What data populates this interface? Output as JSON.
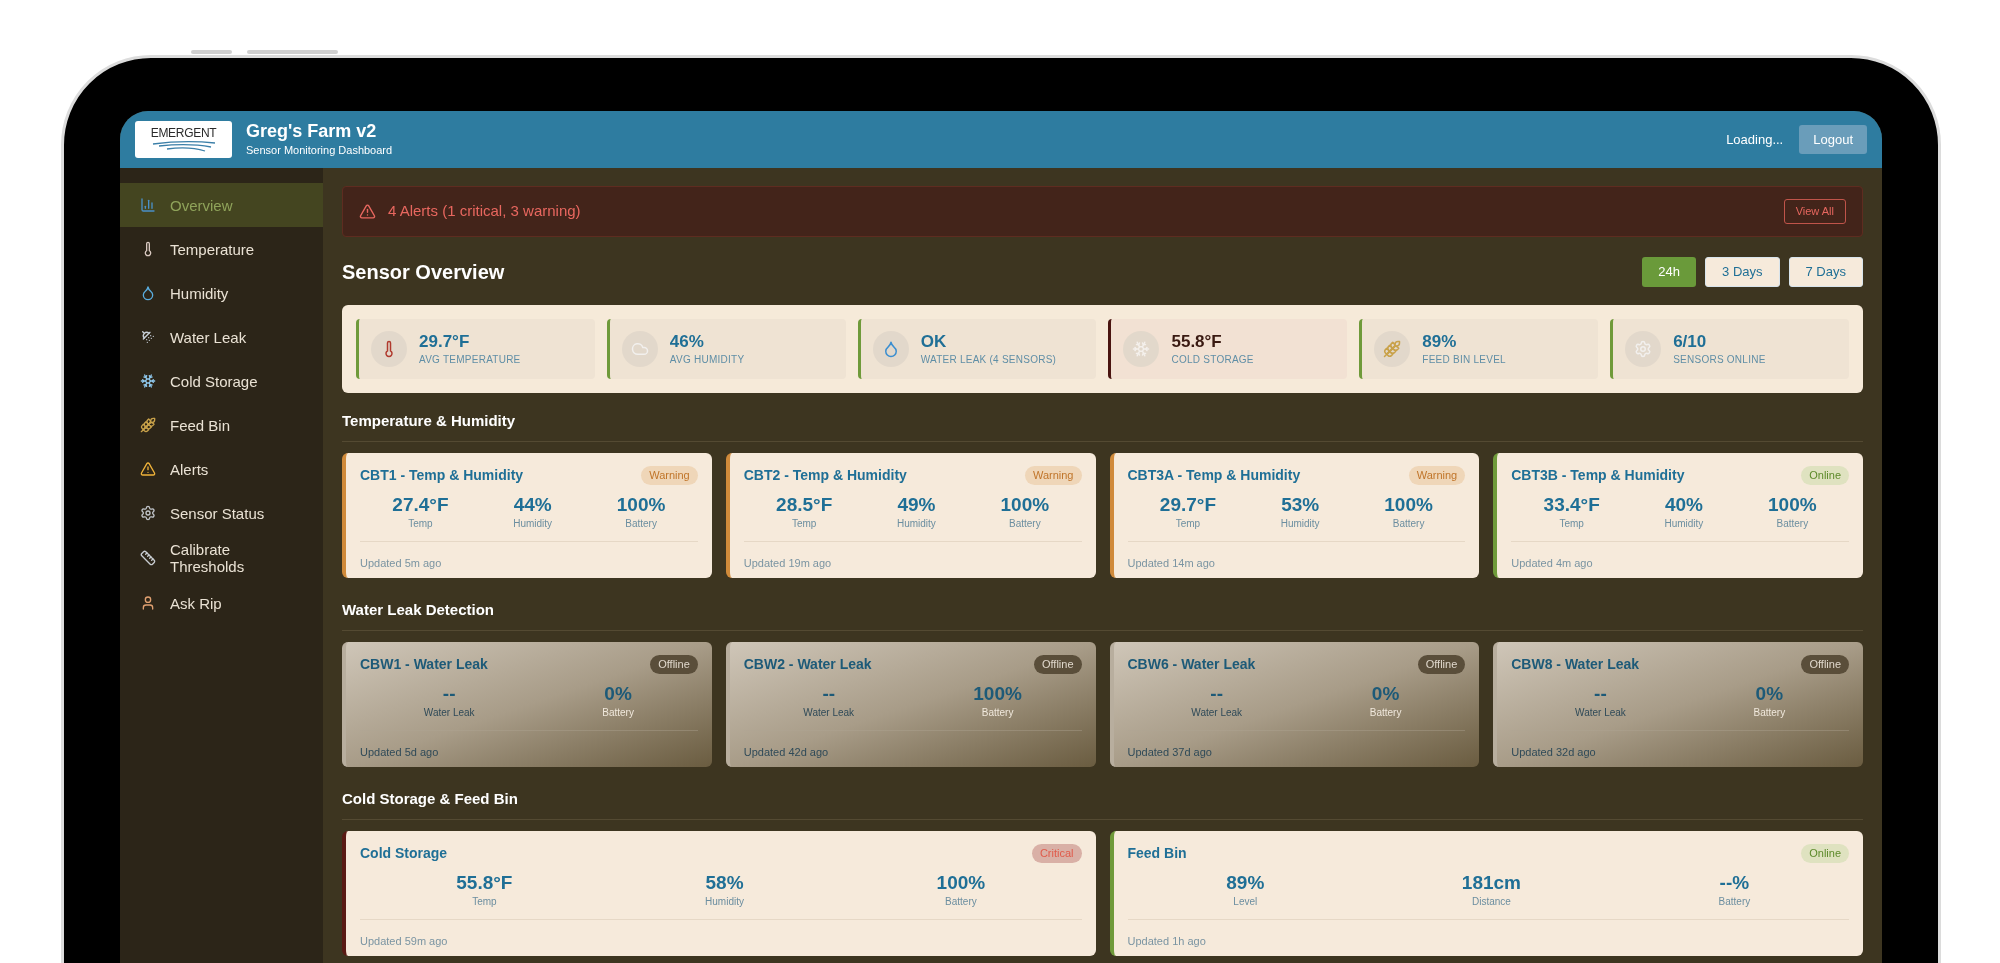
{
  "header": {
    "logo": "EMERGENT",
    "title": "Greg's Farm v2",
    "subtitle": "Sensor Monitoring Dashboard",
    "status": "Loading...",
    "logout": "Logout"
  },
  "sidebar": {
    "items": [
      {
        "label": "Overview",
        "selected": true
      },
      {
        "label": "Temperature",
        "selected": false
      },
      {
        "label": "Humidity",
        "selected": false
      },
      {
        "label": "Water Leak",
        "selected": false
      },
      {
        "label": "Cold Storage",
        "selected": false
      },
      {
        "label": "Feed Bin",
        "selected": false
      },
      {
        "label": "Alerts",
        "selected": false
      },
      {
        "label": "Sensor Status",
        "selected": false
      },
      {
        "label": "Calibrate Thresholds",
        "selected": false
      },
      {
        "label": "Ask Rip",
        "selected": false
      }
    ]
  },
  "alert": {
    "text": "4 Alerts (1 critical, 3 warning)",
    "button": "View All"
  },
  "overview": {
    "title": "Sensor Overview",
    "ranges": [
      {
        "label": "24h",
        "selected": true
      },
      {
        "label": "3 Days",
        "selected": false
      },
      {
        "label": "7 Days",
        "selected": false
      }
    ],
    "summary": [
      {
        "value": "29.7°F",
        "label": "AVG TEMPERATURE",
        "kind": "ok"
      },
      {
        "value": "46%",
        "label": "AVG HUMIDITY",
        "kind": "ok"
      },
      {
        "value": "OK",
        "label": "WATER LEAK (4 SENSORS)",
        "kind": "ok"
      },
      {
        "value": "55.8°F",
        "label": "COLD STORAGE",
        "kind": "critical"
      },
      {
        "value": "89%",
        "label": "FEED BIN LEVEL",
        "kind": "ok"
      },
      {
        "value": "6/10",
        "label": "SENSORS ONLINE",
        "kind": "ok"
      }
    ]
  },
  "sections": [
    {
      "title": "Temperature & Humidity",
      "cards": [
        {
          "name": "CBT1 - Temp & Humidity",
          "badge": "Warning",
          "kind": "warning",
          "metrics": [
            {
              "value": "27.4°F",
              "label": "Temp"
            },
            {
              "value": "44%",
              "label": "Humidity"
            },
            {
              "value": "100%",
              "label": "Battery"
            }
          ],
          "updated": "Updated 5m ago"
        },
        {
          "name": "CBT2 - Temp & Humidity",
          "badge": "Warning",
          "kind": "warning",
          "metrics": [
            {
              "value": "28.5°F",
              "label": "Temp"
            },
            {
              "value": "49%",
              "label": "Humidity"
            },
            {
              "value": "100%",
              "label": "Battery"
            }
          ],
          "updated": "Updated 19m ago"
        },
        {
          "name": "CBT3A - Temp & Humidity",
          "badge": "Warning",
          "kind": "warning",
          "metrics": [
            {
              "value": "29.7°F",
              "label": "Temp"
            },
            {
              "value": "53%",
              "label": "Humidity"
            },
            {
              "value": "100%",
              "label": "Battery"
            }
          ],
          "updated": "Updated 14m ago"
        },
        {
          "name": "CBT3B - Temp & Humidity",
          "badge": "Online",
          "kind": "online",
          "metrics": [
            {
              "value": "33.4°F",
              "label": "Temp"
            },
            {
              "value": "40%",
              "label": "Humidity"
            },
            {
              "value": "100%",
              "label": "Battery"
            }
          ],
          "updated": "Updated 4m ago"
        }
      ]
    },
    {
      "title": "Water Leak Detection",
      "cards": [
        {
          "name": "CBW1 - Water Leak",
          "badge": "Offline",
          "kind": "offline",
          "metrics": [
            {
              "value": "--",
              "label": "Water Leak"
            },
            {
              "value": "0%",
              "label": "Battery"
            }
          ],
          "updated": "Updated 5d ago"
        },
        {
          "name": "CBW2 - Water Leak",
          "badge": "Offline",
          "kind": "offline",
          "metrics": [
            {
              "value": "--",
              "label": "Water Leak"
            },
            {
              "value": "100%",
              "label": "Battery"
            }
          ],
          "updated": "Updated 42d ago"
        },
        {
          "name": "CBW6 - Water Leak",
          "badge": "Offline",
          "kind": "offline",
          "metrics": [
            {
              "value": "--",
              "label": "Water Leak"
            },
            {
              "value": "0%",
              "label": "Battery"
            }
          ],
          "updated": "Updated 37d ago"
        },
        {
          "name": "CBW8 - Water Leak",
          "badge": "Offline",
          "kind": "offline",
          "metrics": [
            {
              "value": "--",
              "label": "Water Leak"
            },
            {
              "value": "0%",
              "label": "Battery"
            }
          ],
          "updated": "Updated 32d ago"
        }
      ]
    },
    {
      "title": "Cold Storage & Feed Bin",
      "cards": [
        {
          "name": "Cold Storage",
          "badge": "Critical",
          "kind": "critical",
          "metrics": [
            {
              "value": "55.8°F",
              "label": "Temp"
            },
            {
              "value": "58%",
              "label": "Humidity"
            },
            {
              "value": "100%",
              "label": "Battery"
            }
          ],
          "updated": "Updated 59m ago"
        },
        {
          "name": "Feed Bin",
          "badge": "Online",
          "kind": "online",
          "metrics": [
            {
              "value": "89%",
              "label": "Level"
            },
            {
              "value": "181cm",
              "label": "Distance"
            },
            {
              "value": "--%",
              "label": "Battery"
            }
          ],
          "updated": "Updated 1h ago"
        }
      ]
    }
  ]
}
